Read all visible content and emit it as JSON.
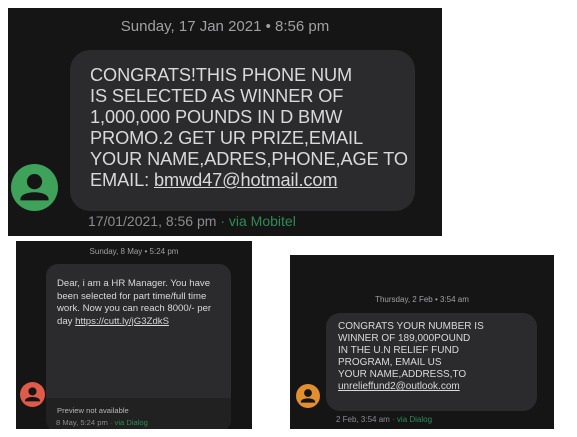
{
  "conversations": [
    {
      "date_header": "Sunday, 17 Jan 2021 • 8:56 pm",
      "message": "CONGRATS!THIS PHONE NUM\nIS SELECTED AS WINNER OF\n1,000,000 POUNDS IN D BMW\nPROMO.2 GET UR PRIZE,EMAIL\nYOUR NAME,ADRES,PHONE,AGE TO\nEMAIL: ",
      "link": "bmwd47@hotmail.com",
      "timestamp": "17/01/2021, 8:56 pm",
      "separator": " · ",
      "via": "via Mobitel",
      "avatar_color": "#3fa25a",
      "avatar_icon": "person-icon"
    },
    {
      "date_header": "Sunday, 8 May • 5:24 pm",
      "message": "Dear, i am a HR Manager. You have\nbeen selected for part time/full time\nwork. Now you can reach 8000/- per\nday ",
      "link": "https://cutt.ly/jG3ZdkS",
      "preview": "Preview not available",
      "timestamp": "8 May, 5:24 pm",
      "separator": " · ",
      "via": "via Dialog",
      "avatar_color": "#e05a4a",
      "avatar_icon": "person-icon"
    },
    {
      "date_header": "Thursday, 2 Feb • 3:54 am",
      "message": "CONGRATS YOUR NUMBER IS\nWINNER OF 189,000POUND\nIN THE U.N RELIEF FUND\nPROGRAM, EMAIL US\nYOUR  NAME,ADDRESS,TO\n",
      "link": "unrelieffund2@outlook.com",
      "timestamp": "2 Feb, 3:54 am",
      "separator": " · ",
      "via": "via Dialog",
      "avatar_color": "#e38e2f",
      "avatar_icon": "person-icon"
    }
  ]
}
